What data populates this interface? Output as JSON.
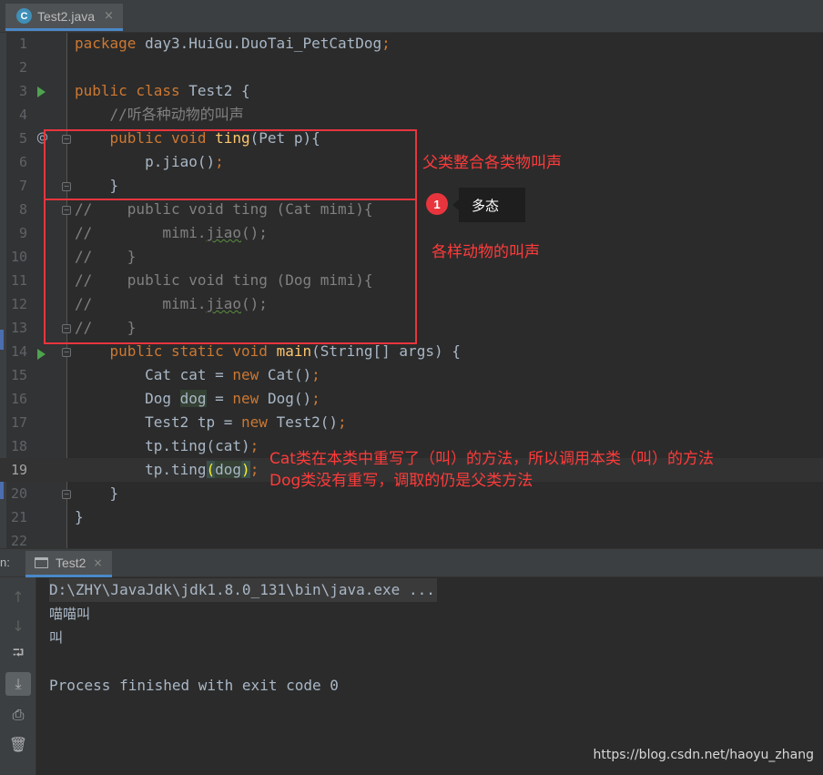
{
  "editor_tab": {
    "icon": "java-class-icon",
    "label": "Test2.java",
    "close": "×"
  },
  "code_lines": [
    {
      "num": "1",
      "tokens": [
        {
          "t": "package ",
          "c": "kw"
        },
        {
          "t": "day3.HuiGu.DuoTai_PetCatDog",
          "c": "pl"
        },
        {
          "t": ";",
          "c": "kw"
        }
      ]
    },
    {
      "num": "2",
      "tokens": []
    },
    {
      "num": "3",
      "tokens": [
        {
          "t": "public class ",
          "c": "kw"
        },
        {
          "t": "Test2 {",
          "c": "pl"
        }
      ]
    },
    {
      "num": "4",
      "tokens": [
        {
          "t": "    //听各种动物的叫声",
          "c": "cm"
        }
      ]
    },
    {
      "num": "5",
      "tokens": [
        {
          "t": "    ",
          "c": "pl"
        },
        {
          "t": "public void ",
          "c": "kw"
        },
        {
          "t": "ting",
          "c": "fn"
        },
        {
          "t": "(Pet p){",
          "c": "pl"
        }
      ]
    },
    {
      "num": "6",
      "tokens": [
        {
          "t": "        p.jiao()",
          "c": "pl"
        },
        {
          "t": ";",
          "c": "kw"
        }
      ]
    },
    {
      "num": "7",
      "tokens": [
        {
          "t": "    }",
          "c": "pl"
        }
      ]
    },
    {
      "num": "8",
      "tokens": [
        {
          "t": "//    public void ting (Cat mimi){",
          "c": "cm"
        }
      ]
    },
    {
      "num": "9",
      "tokens": [
        {
          "t": "//        mimi.",
          "c": "cm"
        },
        {
          "t": "jiao",
          "c": "cm squig"
        },
        {
          "t": "();",
          "c": "cm"
        }
      ]
    },
    {
      "num": "10",
      "tokens": [
        {
          "t": "//    }",
          "c": "cm"
        }
      ]
    },
    {
      "num": "11",
      "tokens": [
        {
          "t": "//    public void ting (Dog mimi){",
          "c": "cm"
        }
      ]
    },
    {
      "num": "12",
      "tokens": [
        {
          "t": "//        mimi.",
          "c": "cm"
        },
        {
          "t": "jiao",
          "c": "cm squig"
        },
        {
          "t": "();",
          "c": "cm"
        }
      ]
    },
    {
      "num": "13",
      "tokens": [
        {
          "t": "//    }",
          "c": "cm"
        }
      ]
    },
    {
      "num": "14",
      "tokens": [
        {
          "t": "    ",
          "c": "pl"
        },
        {
          "t": "public static void ",
          "c": "kw"
        },
        {
          "t": "main",
          "c": "fn"
        },
        {
          "t": "(String[] args) {",
          "c": "pl"
        }
      ]
    },
    {
      "num": "15",
      "tokens": [
        {
          "t": "        Cat cat = ",
          "c": "pl"
        },
        {
          "t": "new ",
          "c": "kw"
        },
        {
          "t": "Cat()",
          "c": "pl"
        },
        {
          "t": ";",
          "c": "kw"
        }
      ]
    },
    {
      "num": "16",
      "tokens": [
        {
          "t": "        Dog ",
          "c": "pl"
        },
        {
          "t": "dog",
          "c": "pl var-hl"
        },
        {
          "t": " = ",
          "c": "pl"
        },
        {
          "t": "new ",
          "c": "kw"
        },
        {
          "t": "Dog()",
          "c": "pl"
        },
        {
          "t": ";",
          "c": "kw"
        }
      ]
    },
    {
      "num": "17",
      "tokens": [
        {
          "t": "        Test2 tp = ",
          "c": "pl"
        },
        {
          "t": "new ",
          "c": "kw"
        },
        {
          "t": "Test2()",
          "c": "pl"
        },
        {
          "t": ";",
          "c": "kw"
        }
      ]
    },
    {
      "num": "18",
      "tokens": [
        {
          "t": "        tp.ting(cat)",
          "c": "pl"
        },
        {
          "t": ";",
          "c": "kw"
        }
      ]
    },
    {
      "num": "19",
      "tokens": [
        {
          "t": "        tp.ting",
          "c": "pl"
        },
        {
          "t": "(",
          "c": "paren-hl"
        },
        {
          "t": "dog",
          "c": "pl var-hl"
        },
        {
          "t": ")",
          "c": "paren-hl"
        },
        {
          "t": ";",
          "c": "kw"
        }
      ]
    },
    {
      "num": "20",
      "tokens": [
        {
          "t": "    }",
          "c": "pl"
        }
      ]
    },
    {
      "num": "21",
      "tokens": [
        {
          "t": "}",
          "c": "pl"
        }
      ]
    },
    {
      "num": "22",
      "tokens": []
    }
  ],
  "annotations": {
    "parent_call": "父类整合各类物叫声",
    "animal_calls": "各样动物的叫声",
    "cat_note": "Cat类在本类中重写了（叫）的方法，所以调用本类（叫）的方法",
    "dog_note": "Dog类没有重写，调取的仍是父类方法",
    "badge_number": "1",
    "tooltip": "多态",
    "highlight_color": "#e8353d"
  },
  "run_panel": {
    "prefix": "n:",
    "tab_label": "Test2",
    "tab_close": "×",
    "tools": [
      "up-arrow-icon",
      "down-arrow-icon",
      "soft-wrap-icon",
      "scroll-to-end-icon",
      "print-icon",
      "trash-icon"
    ],
    "output": [
      "D:\\ZHY\\JavaJdk\\jdk1.8.0_131\\bin\\java.exe ...",
      "喵喵叫",
      "叫",
      "",
      "Process finished with exit code 0"
    ]
  },
  "watermark": "https://blog.csdn.net/haoyu_zhang",
  "colors": {
    "keyword": "#cc7832",
    "function": "#ffc66d",
    "comment": "#808080",
    "text": "#a9b7c6",
    "background": "#2b2b2b"
  }
}
